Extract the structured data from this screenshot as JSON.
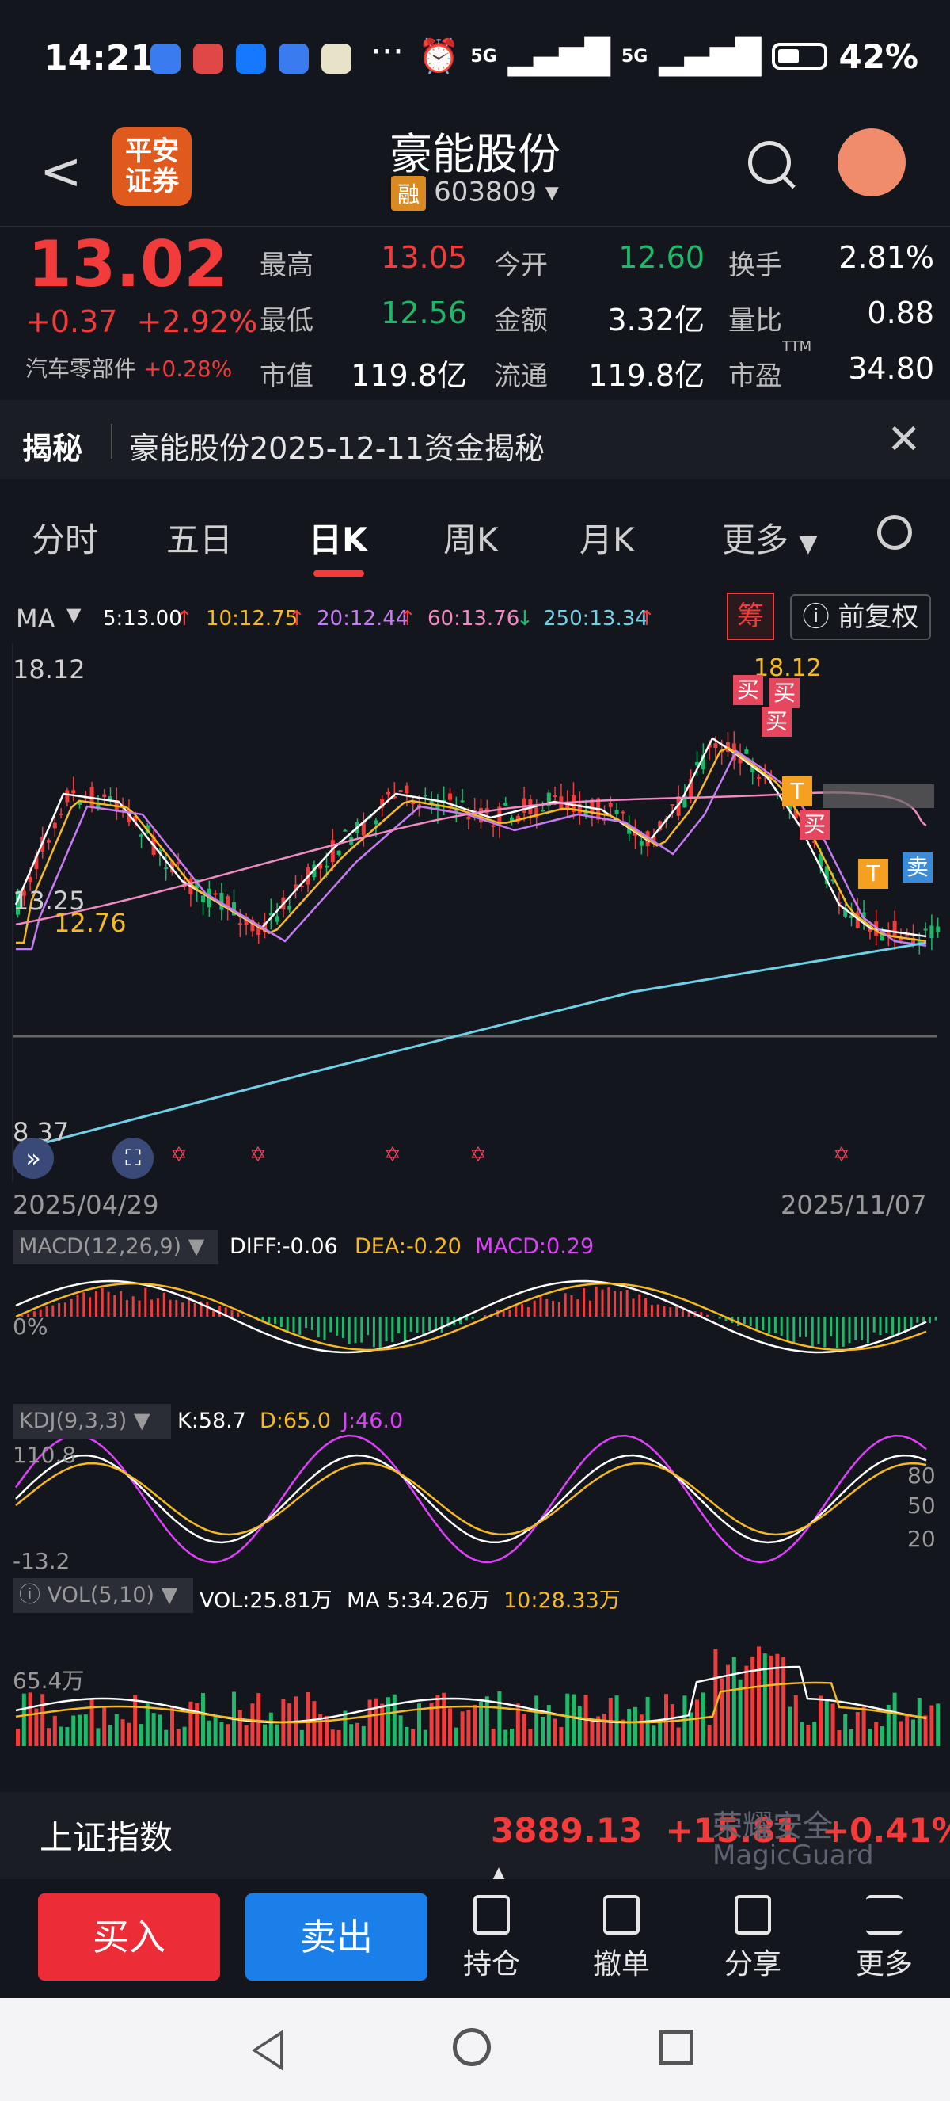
{
  "status": {
    "time": "14:21",
    "dots": "···",
    "network1": "5G",
    "network2": "5G",
    "battery": "42%"
  },
  "header": {
    "broker": "平安\n证券",
    "name": "豪能股份",
    "rong": "融",
    "code": "603809"
  },
  "quote": {
    "price": "13.02",
    "change": "+0.37",
    "pct": "+2.92%",
    "sector": "汽车零部件",
    "sector_pct": "+0.28%",
    "rows": [
      [
        {
          "l": "最高",
          "v": "13.05",
          "c": "red"
        },
        {
          "l": "今开",
          "v": "12.60",
          "c": "green"
        },
        {
          "l": "换手",
          "v": "2.81%",
          "c": "white"
        }
      ],
      [
        {
          "l": "最低",
          "v": "12.56",
          "c": "green"
        },
        {
          "l": "金额",
          "v": "3.32亿",
          "c": "white"
        },
        {
          "l": "量比",
          "v": "0.88",
          "c": "white"
        }
      ],
      [
        {
          "l": "市值",
          "v": "119.8亿",
          "c": "white"
        },
        {
          "l": "流通",
          "v": "119.8亿",
          "c": "white"
        },
        {
          "l": "市盈",
          "v": "34.80",
          "c": "white"
        }
      ]
    ],
    "ttm": "TTM"
  },
  "reveal": {
    "tag": "揭秘",
    "text": "豪能股份2025-12-11资金揭秘"
  },
  "tabs": [
    "分时",
    "五日",
    "日K",
    "周K",
    "月K",
    "更多"
  ],
  "ma_bar": {
    "label": "MA",
    "items": [
      {
        "t": "5:13.00",
        "a": "↑",
        "color": "#ffffff"
      },
      {
        "t": "10:12.75",
        "a": "↑",
        "color": "#f5b921"
      },
      {
        "t": "20:12.44",
        "a": "↑",
        "color": "#c57bf2"
      },
      {
        "t": "60:13.76",
        "a": "↓",
        "color": "#f08ac2"
      },
      {
        "t": "250:13.34",
        "a": "↑",
        "color": "#6fd0e6"
      }
    ],
    "chou": "筹",
    "fq": "前复权"
  },
  "kline": {
    "high_label": "18.12",
    "high_mark": "18.12",
    "mid_label": "13.25",
    "ma_mark": "12.76",
    "low_label": "8.37",
    "date_start": "2025/04/29",
    "date_end": "2025/11/07",
    "buy": "买",
    "sell": "卖",
    "t": "T"
  },
  "macd": {
    "name": "MACD(12,26,9)",
    "diff": "DIFF:-0.06",
    "dea": "DEA:-0.20",
    "macd": "MACD:0.29",
    "zero": "0%"
  },
  "kdj": {
    "name": "KDJ(9,3,3)",
    "k": "K:58.7",
    "d": "D:65.0",
    "j": "J:46.0",
    "top": "110.8",
    "bottom": "-13.2",
    "l80": "80",
    "l50": "50",
    "l20": "20"
  },
  "vol": {
    "name": "VOL(5,10)",
    "vol": "VOL:25.81万",
    "ma5": "MA 5:34.26万",
    "ma10": "10:28.33万",
    "axis": "65.4万"
  },
  "index": {
    "name": "上证指数",
    "value": "3889.13",
    "change": "+15.81",
    "pct": "+0.41%",
    "wm1": "荣耀安全",
    "wm2": "MagicGuard"
  },
  "bottom": {
    "buy": "买入",
    "sell": "卖出",
    "items": [
      "持仓",
      "撤单",
      "分享",
      "更多"
    ]
  },
  "colors": {
    "up": "#f23b3b",
    "down": "#1fb86a",
    "bg": "#14161d"
  }
}
